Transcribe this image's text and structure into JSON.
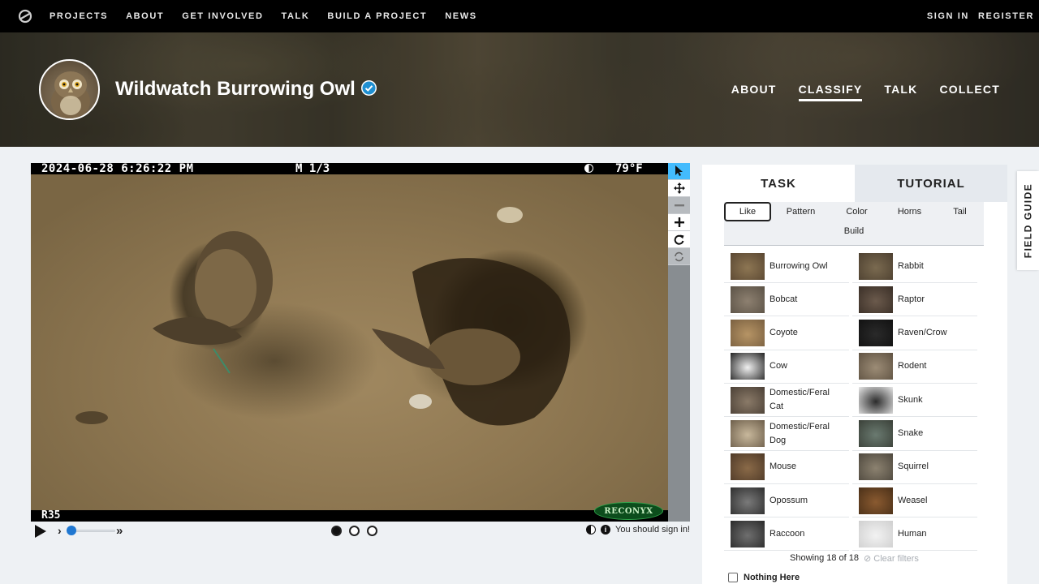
{
  "topnav": {
    "links": [
      "PROJECTS",
      "ABOUT",
      "GET INVOLVED",
      "TALK",
      "BUILD A PROJECT",
      "NEWS"
    ],
    "sign_in": "SIGN IN",
    "register": "REGISTER"
  },
  "project": {
    "title": "Wildwatch Burrowing Owl",
    "nav": [
      "ABOUT",
      "CLASSIFY",
      "TALK",
      "COLLECT"
    ],
    "active_nav": "CLASSIFY"
  },
  "camera": {
    "timestamp": "2024-06-28  6:26:22 PM",
    "mode": "M 1/3",
    "temperature": "79°F",
    "camera_id": "R35",
    "brand": "RECONYX"
  },
  "viewer": {
    "tools": [
      "pointer-icon",
      "pan-icon",
      "zoom-out-icon",
      "zoom-in-icon",
      "rotate-icon",
      "reset-icon"
    ],
    "frames_total": 3,
    "current_frame": 1,
    "sign_in_note": "You should sign in!"
  },
  "panel": {
    "tab_task": "TASK",
    "tab_tutorial": "TUTORIAL",
    "filters": [
      "Like",
      "Pattern",
      "Color",
      "Horns",
      "Tail"
    ],
    "build_filter": "Build",
    "choices": [
      "Burrowing Owl",
      "Rabbit",
      "Bobcat",
      "Raptor",
      "Coyote",
      "Raven/Crow",
      "Cow",
      "Rodent",
      "Domestic/Feral Cat",
      "Skunk",
      "Domestic/Feral Dog",
      "Snake",
      "Mouse",
      "Squirrel",
      "Opossum",
      "Weasel",
      "Raccoon",
      "Human"
    ],
    "showing": "Showing 18 of 18",
    "clear_filters": "Clear filters",
    "nothing_here": "Nothing Here"
  },
  "field_guide": "FIELD GUIDE",
  "colors": {
    "accent_blue": "#43bbfd",
    "nav_bg": "#000000",
    "panel_bg": "#ffffff",
    "page_bg": "#eef1f4"
  }
}
